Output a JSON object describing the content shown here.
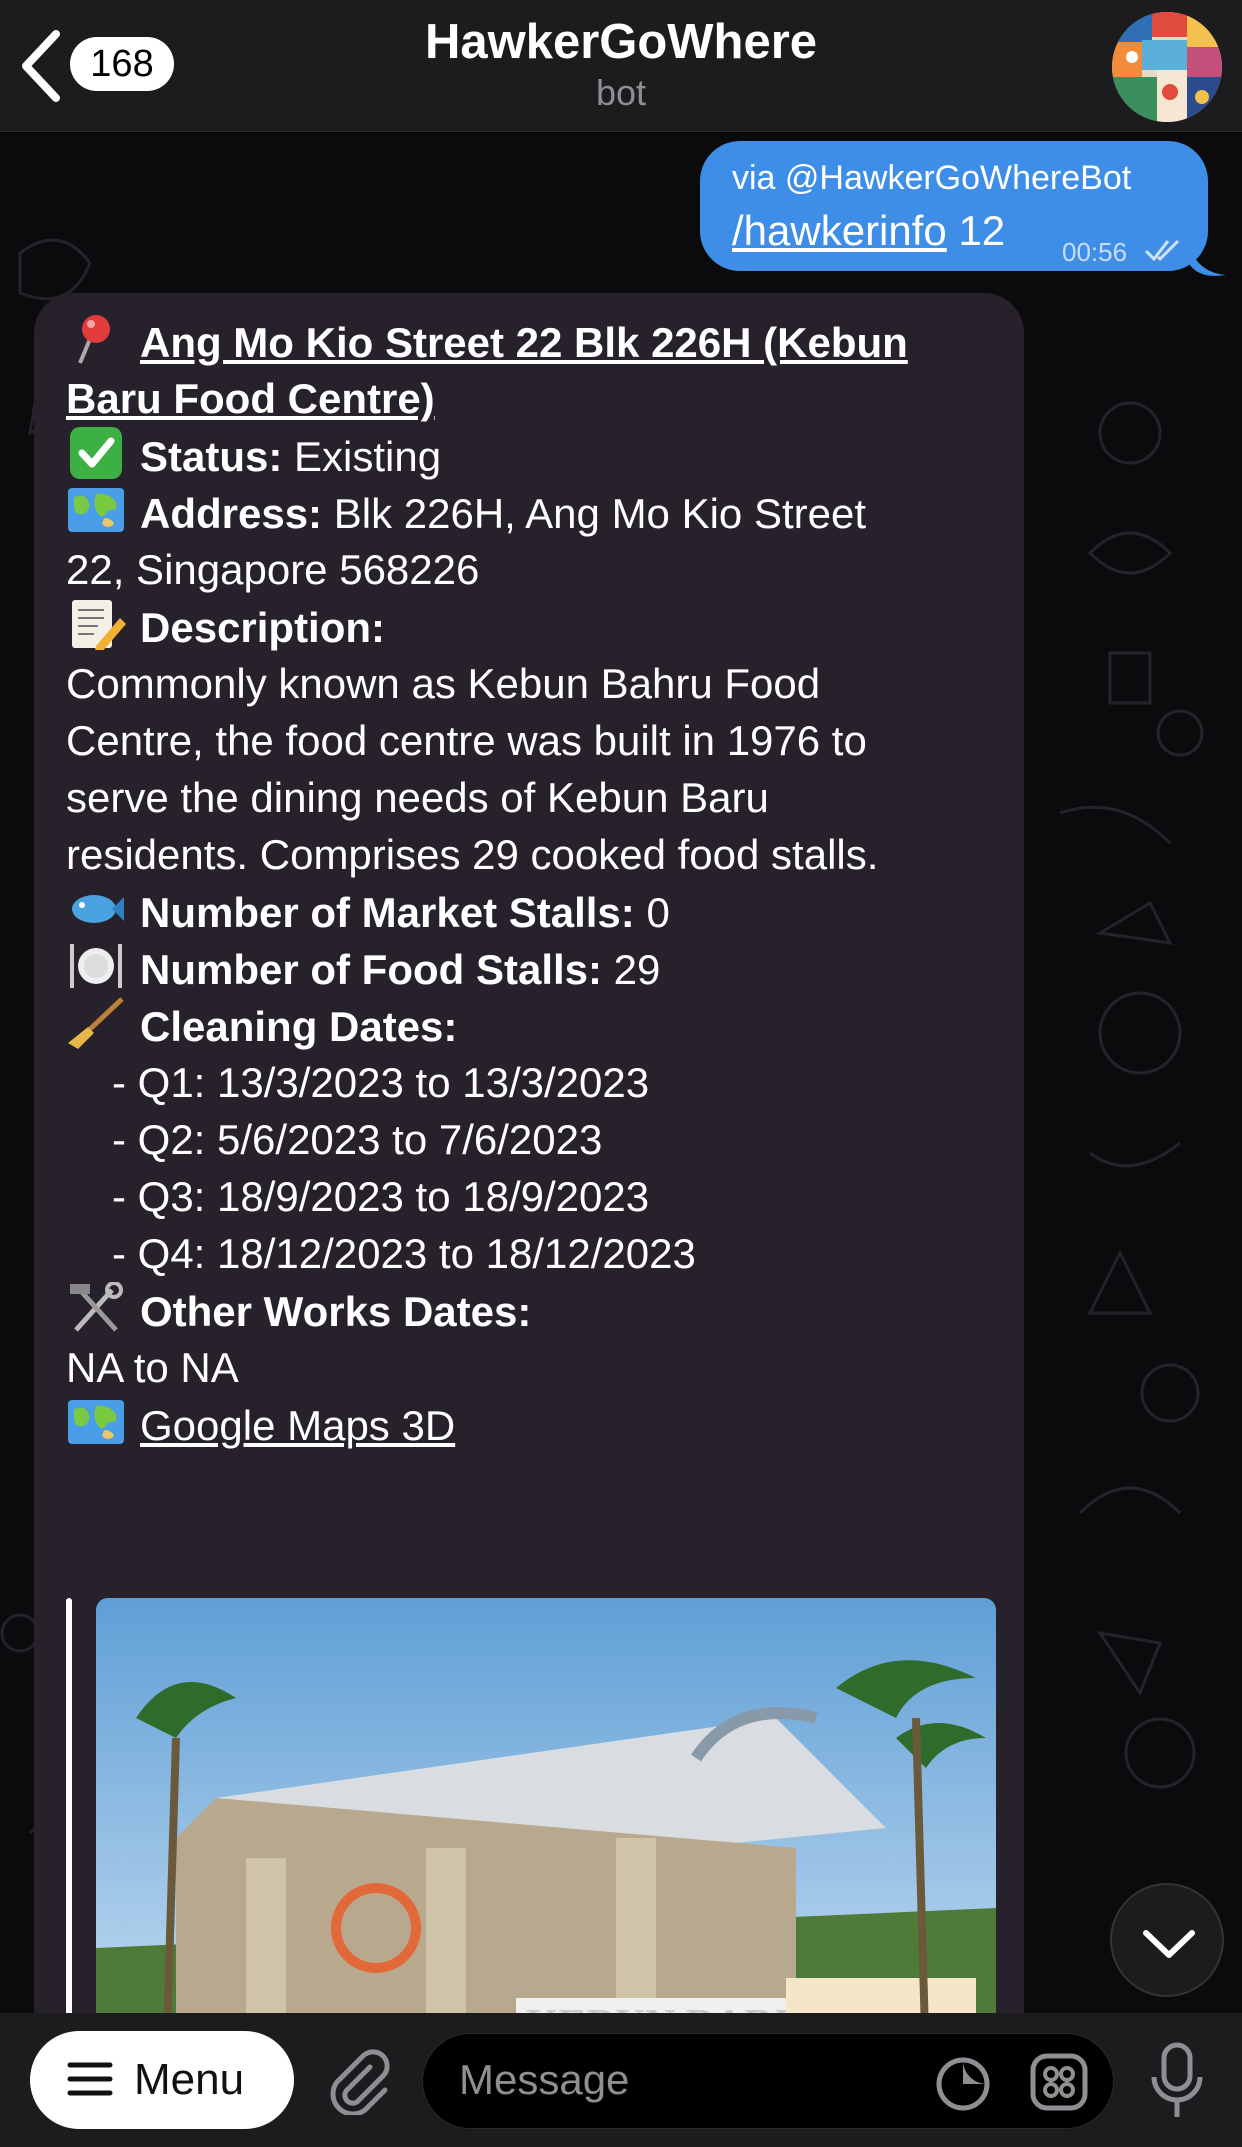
{
  "header": {
    "back_badge": "168",
    "title": "HawkerGoWhere",
    "subtitle": "bot",
    "avatar_icon": "bot-avatar-collage"
  },
  "outgoing": {
    "via": "via @HawkerGoWhereBot",
    "command": "/hawkerinfo",
    "argument": " 12",
    "time": "00:56",
    "status_icon": "double-check-icon"
  },
  "incoming": {
    "title_line1": "Ang Mo Kio Street 22 Blk 226H (Kebun",
    "title_line2": "Baru Food Centre)",
    "status_label": "Status:",
    "status_value": " Existing",
    "address_label": "Address:",
    "address_value_line1": " Blk 226H, Ang Mo Kio Street",
    "address_value_line2": "22, Singapore 568226",
    "description_label": "Description:",
    "description_lines": [
      "Commonly known as Kebun Bahru Food",
      "Centre, the food centre was built in 1976 to",
      "serve the dining needs of Kebun Baru",
      "residents. Comprises 29 cooked food stalls."
    ],
    "market_stalls_label": "Number of Market Stalls:",
    "market_stalls_value": " 0",
    "food_stalls_label": "Number of Food Stalls:",
    "food_stalls_value": " 29",
    "cleaning_label": "Cleaning Dates:",
    "cleaning_dates": [
      "- Q1: 13/3/2023 to 13/3/2023",
      "- Q2: 5/6/2023 to 7/6/2023",
      "- Q3: 18/9/2023 to 18/9/2023",
      "- Q4: 18/12/2023 to 18/12/2023"
    ],
    "other_works_label": "Other Works Dates:",
    "other_works_value": "NA to NA",
    "maps_link": "Google Maps 3D",
    "preview_image_sign": "KEBUN BARU"
  },
  "input_bar": {
    "menu_label": "Menu",
    "placeholder": "Message"
  },
  "colors": {
    "outgoing_bubble": "#3e8ee8",
    "incoming_bubble": "#26212b",
    "header_bg": "#1c1c1e"
  }
}
